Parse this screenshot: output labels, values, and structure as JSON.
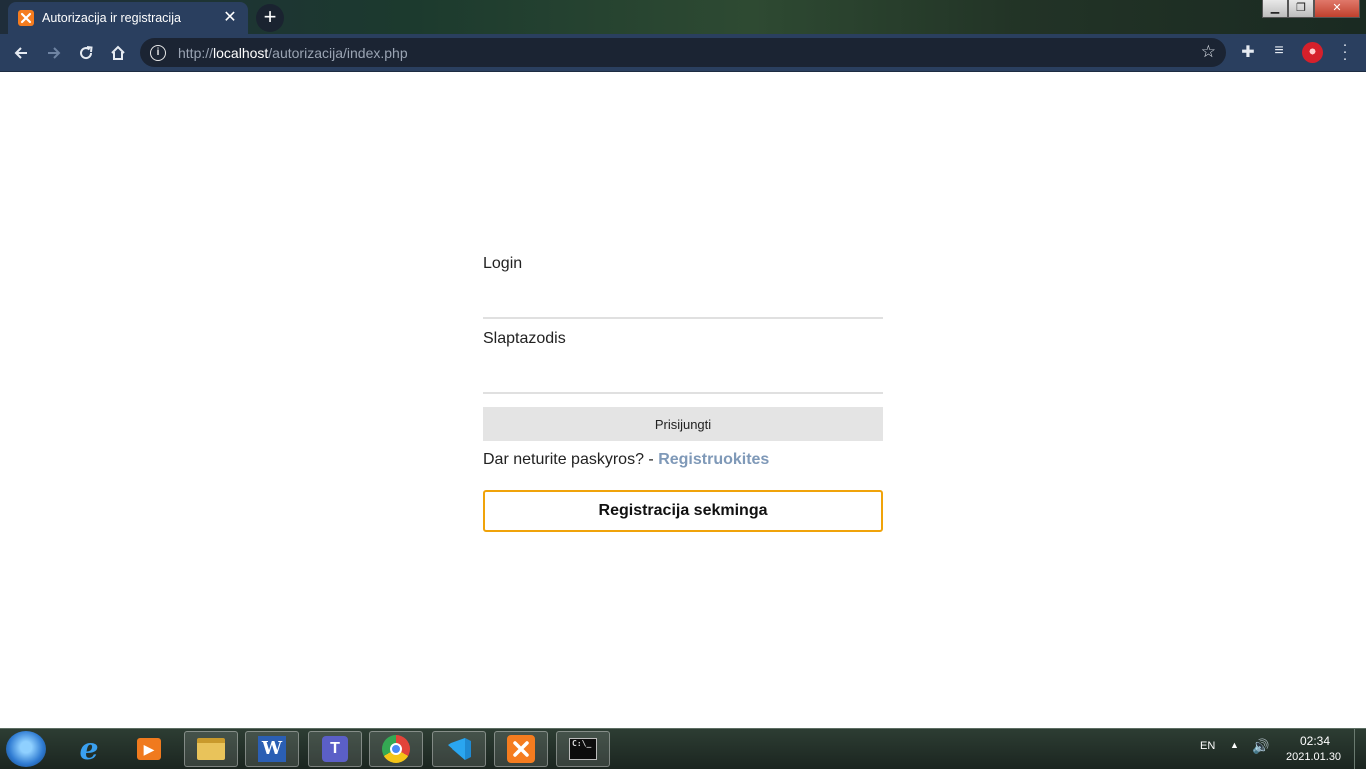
{
  "browser": {
    "tab_title": "Autorizacija ir registracija",
    "tab_close": "✕",
    "new_tab": "+",
    "url_scheme": "http://",
    "url_host": "localhost",
    "url_path": "/autorizacija/index.php",
    "window_controls": [
      "minimize",
      "maximize",
      "close"
    ]
  },
  "form": {
    "login_label": "Login",
    "password_label": "Slaptazodis",
    "submit_label": "Prisijungti",
    "no_account_text": "Dar neturite paskyros? - ",
    "register_link": "Registruokites",
    "message": "Registracija sekminga"
  },
  "taskbar": {
    "apps": [
      "internet-explorer-icon",
      "media-player-icon",
      "file-explorer-icon",
      "word-icon",
      "teams-icon",
      "chrome-icon",
      "vscode-icon",
      "xampp-icon",
      "cmd-icon"
    ],
    "language": "EN",
    "time": "02:34",
    "date": "2021.01.30"
  },
  "colors": {
    "browser_chrome": "#2a3f5f",
    "link": "#7f99b8",
    "message_border": "#f0a30a",
    "button_bg": "#e4e4e4"
  }
}
